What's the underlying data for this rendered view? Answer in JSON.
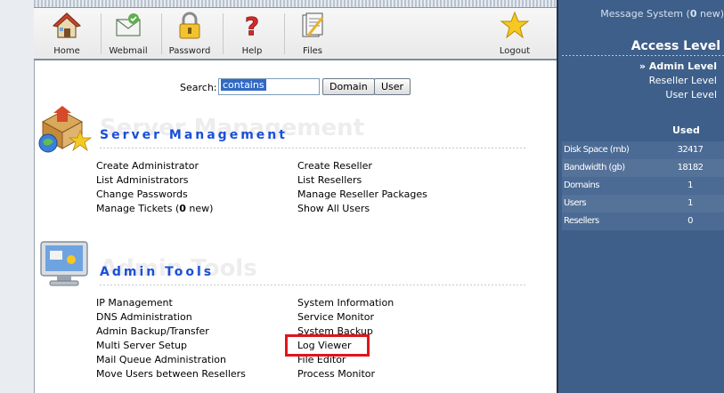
{
  "toolbar": {
    "items": [
      {
        "label": "Home",
        "icon": "house-icon"
      },
      {
        "label": "Webmail",
        "icon": "mail-icon"
      },
      {
        "label": "Password",
        "icon": "padlock-icon"
      },
      {
        "label": "Help",
        "icon": "question-icon"
      },
      {
        "label": "Files",
        "icon": "files-icon"
      },
      {
        "label": "Logout",
        "icon": "star-icon"
      }
    ]
  },
  "search": {
    "label": "Search:",
    "value": "contains",
    "domain_button": "Domain",
    "user_button": "User"
  },
  "server_management": {
    "title": "Server Management",
    "col1": [
      "Create Administrator",
      "List Administrators",
      "Change Passwords"
    ],
    "manage_tickets": {
      "prefix": "Manage Tickets (",
      "count": "0",
      "suffix": " new)"
    },
    "col2": [
      "Create Reseller",
      "List Resellers",
      "Manage Reseller Packages",
      "Show All Users"
    ]
  },
  "admin_tools": {
    "title": "Admin Tools",
    "col1": [
      "IP Management",
      "DNS Administration",
      "Admin Backup/Transfer",
      "Multi Server Setup",
      "Mail Queue Administration",
      "Move Users between Resellers"
    ],
    "col2": [
      "System Information",
      "Service Monitor",
      "System Backup",
      "Log Viewer",
      "File Editor",
      "Process Monitor"
    ]
  },
  "sidebar": {
    "message": {
      "prefix": "Message System (",
      "count": "0",
      "suffix": " new)"
    },
    "access_title": "Access Level",
    "levels": [
      "» Admin Level",
      "Reseller Level",
      "User Level"
    ],
    "used_header": "Used",
    "stats": [
      {
        "label": "Disk Space (mb)",
        "value": "32417"
      },
      {
        "label": "Bandwidth (gb)",
        "value": "18182"
      },
      {
        "label": "Domains",
        "value": "1"
      },
      {
        "label": "Users",
        "value": "1"
      },
      {
        "label": "Resellers",
        "value": "0"
      }
    ]
  },
  "colors": {
    "sidebar_bg": "#3e5f8a",
    "section_title": "#1b4fd8",
    "highlight": "#e0151b"
  }
}
